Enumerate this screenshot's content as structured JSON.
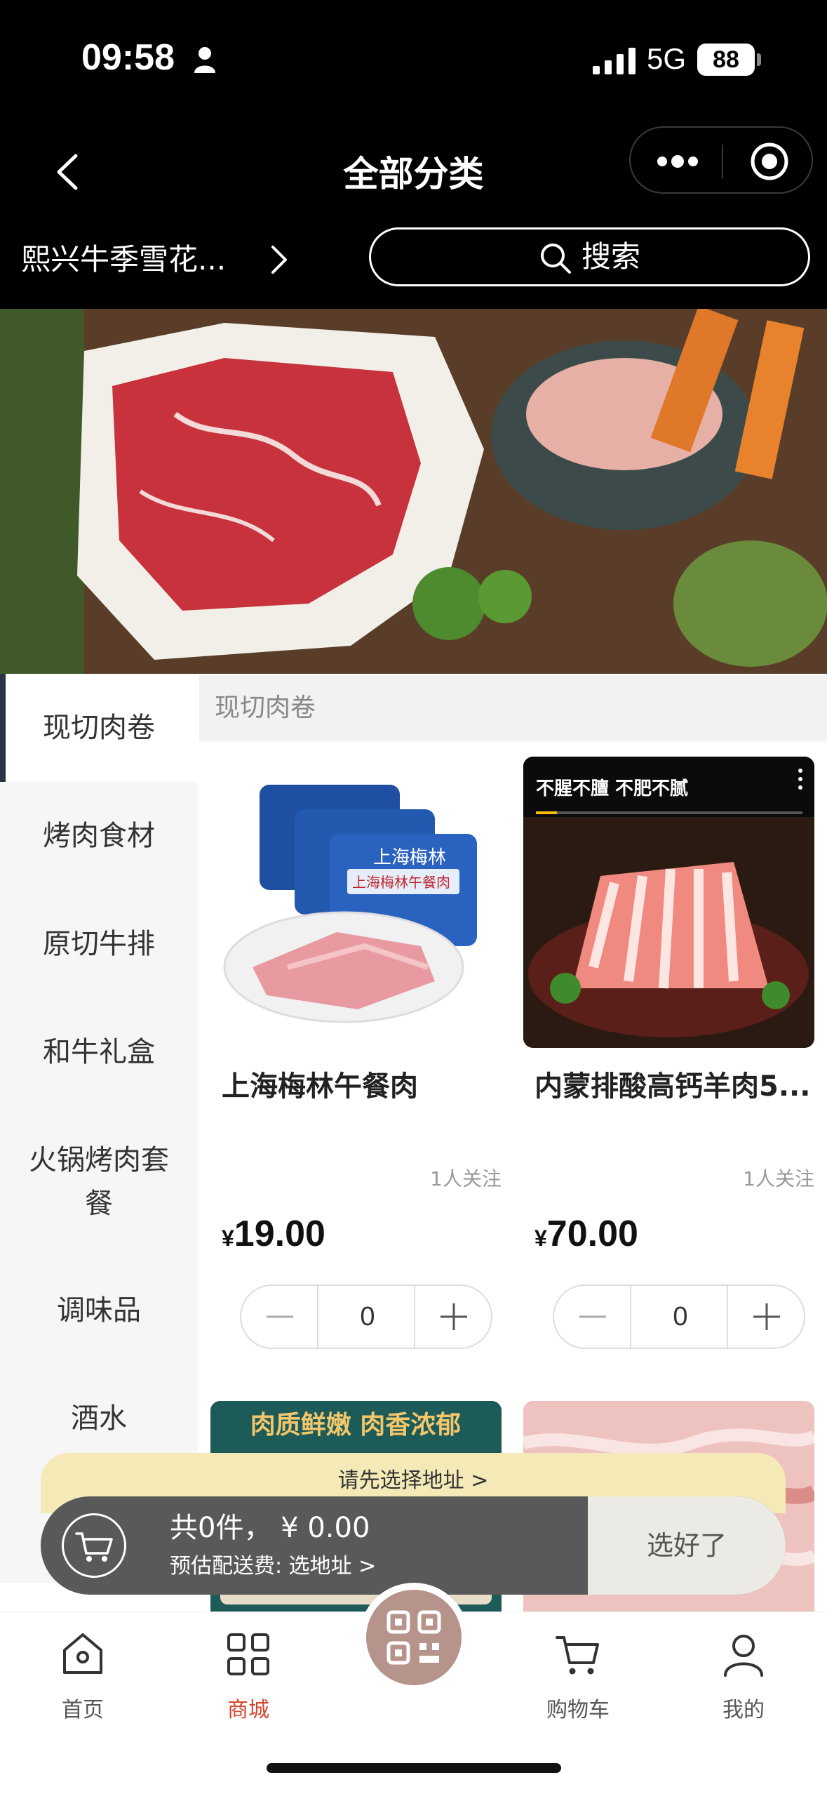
{
  "status_bar": {
    "time": "09:58",
    "network": "5G",
    "battery": "88"
  },
  "nav": {
    "title": "全部分类"
  },
  "store": {
    "name": "熙兴牛季雪花..."
  },
  "search": {
    "label": "搜索"
  },
  "categories": [
    {
      "label": "现切肉卷",
      "active": true
    },
    {
      "label": "烤肉食材"
    },
    {
      "label": "原切牛排"
    },
    {
      "label": "和牛礼盒"
    },
    {
      "label": "火锅烤肉套餐"
    },
    {
      "label": "调味品"
    },
    {
      "label": "酒水"
    }
  ],
  "section": {
    "title": "现切肉卷"
  },
  "products": [
    {
      "name": "上海梅林午餐肉",
      "followers": "1人关注",
      "currency": "¥",
      "price": "19.00",
      "quantity": "0",
      "image_text": {
        "brand": "上海梅林",
        "product": "上海梅林午餐肉"
      }
    },
    {
      "name": "内蒙排酸高钙羊肉5...",
      "followers": "1人关注",
      "currency": "¥",
      "price": "70.00",
      "quantity": "0",
      "image_text": {
        "overlay": "不腥不膻 不肥不腻"
      }
    },
    {
      "image_text": {
        "headline": "肉质鲜嫩 肉香浓郁"
      }
    },
    {}
  ],
  "cart": {
    "address_tip": "请先选择地址 >",
    "summary": "共0件，  ¥ 0.00",
    "fee": "预估配送费: 选地址 >",
    "done_label": "选好了"
  },
  "tabbar": {
    "items": [
      {
        "label": "首页",
        "icon": "home-icon"
      },
      {
        "label": "商城",
        "icon": "grid-icon",
        "active": true
      },
      {
        "label": "",
        "icon": "qr-code-icon"
      },
      {
        "label": "购物车",
        "icon": "cart-icon"
      },
      {
        "label": "我的",
        "icon": "user-icon"
      }
    ]
  },
  "colors": {
    "accent": "#d4462f",
    "sidebar_active_bar": "#2b3444",
    "cart_bar": "#595959",
    "address_tip": "#f4e9b7"
  }
}
